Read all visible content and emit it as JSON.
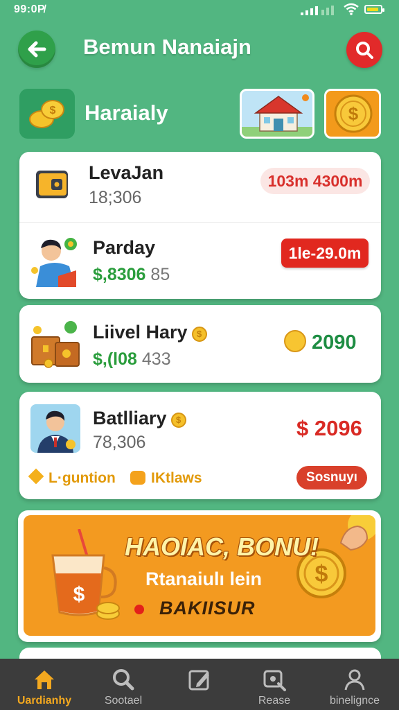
{
  "status_bar": {
    "time": "99:0P̸"
  },
  "header": {
    "title": "Bemun Nanaiajn"
  },
  "category": {
    "label": "Haraialy"
  },
  "rows": [
    {
      "name": "LevaJan",
      "sub": "18;306",
      "badge": "103m 4300m"
    },
    {
      "name": "Parday",
      "sub_green": "$,8306",
      "sub_grey": "85",
      "badge": "1le-29.0m"
    },
    {
      "name": "Liivel Hary",
      "sub_green": "$,(l08",
      "sub_grey": "433",
      "amount": "2090"
    },
    {
      "name": "Batlliary",
      "sub": "78,306",
      "amount": "$ 2096",
      "tags": [
        "L·guntion",
        "IKtlaws"
      ],
      "status": "Sosnuyı"
    }
  ],
  "banner": {
    "title": "HAOIAC, BONU!",
    "subtitle": "Rtanaiulı lein",
    "cta": "BAKIISUR"
  },
  "nav": [
    {
      "label": "Uardianhy",
      "icon": "home-icon",
      "active": true
    },
    {
      "label": "Sootael",
      "icon": "search-icon",
      "active": false
    },
    {
      "label": "",
      "icon": "edit-icon",
      "active": false
    },
    {
      "label": "Rease",
      "icon": "game-icon",
      "active": false
    },
    {
      "label": "binelignce",
      "icon": "profile-icon",
      "active": false
    }
  ],
  "colors": {
    "background": "#52b681",
    "accent_red": "#e1281f",
    "accent_orange": "#f39a20",
    "money_green": "#1e8d43"
  }
}
